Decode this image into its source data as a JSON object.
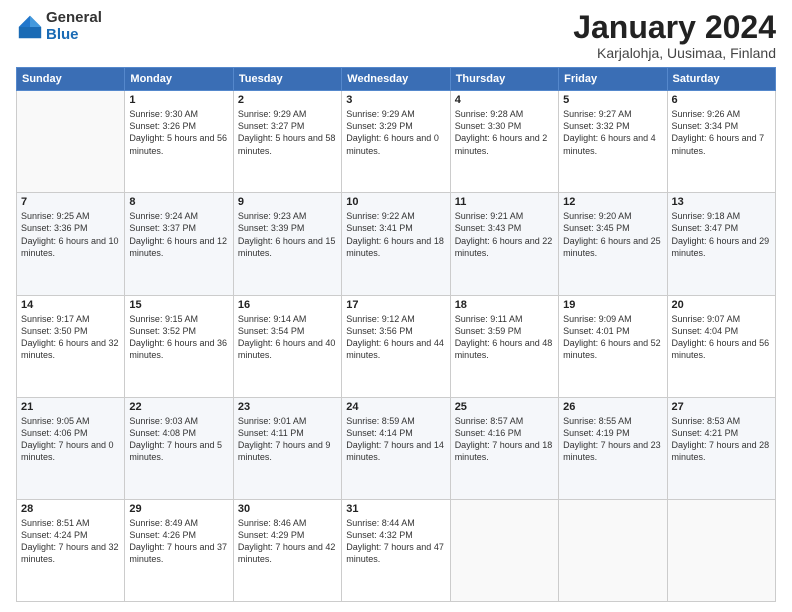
{
  "header": {
    "logo_general": "General",
    "logo_blue": "Blue",
    "title": "January 2024",
    "location": "Karjalohja, Uusimaa, Finland"
  },
  "weekdays": [
    "Sunday",
    "Monday",
    "Tuesday",
    "Wednesday",
    "Thursday",
    "Friday",
    "Saturday"
  ],
  "weeks": [
    [
      {
        "day": "",
        "info": ""
      },
      {
        "day": "1",
        "info": "Sunrise: 9:30 AM\nSunset: 3:26 PM\nDaylight: 5 hours\nand 56 minutes."
      },
      {
        "day": "2",
        "info": "Sunrise: 9:29 AM\nSunset: 3:27 PM\nDaylight: 5 hours\nand 58 minutes."
      },
      {
        "day": "3",
        "info": "Sunrise: 9:29 AM\nSunset: 3:29 PM\nDaylight: 6 hours\nand 0 minutes."
      },
      {
        "day": "4",
        "info": "Sunrise: 9:28 AM\nSunset: 3:30 PM\nDaylight: 6 hours\nand 2 minutes."
      },
      {
        "day": "5",
        "info": "Sunrise: 9:27 AM\nSunset: 3:32 PM\nDaylight: 6 hours\nand 4 minutes."
      },
      {
        "day": "6",
        "info": "Sunrise: 9:26 AM\nSunset: 3:34 PM\nDaylight: 6 hours\nand 7 minutes."
      }
    ],
    [
      {
        "day": "7",
        "info": "Sunrise: 9:25 AM\nSunset: 3:36 PM\nDaylight: 6 hours\nand 10 minutes."
      },
      {
        "day": "8",
        "info": "Sunrise: 9:24 AM\nSunset: 3:37 PM\nDaylight: 6 hours\nand 12 minutes."
      },
      {
        "day": "9",
        "info": "Sunrise: 9:23 AM\nSunset: 3:39 PM\nDaylight: 6 hours\nand 15 minutes."
      },
      {
        "day": "10",
        "info": "Sunrise: 9:22 AM\nSunset: 3:41 PM\nDaylight: 6 hours\nand 18 minutes."
      },
      {
        "day": "11",
        "info": "Sunrise: 9:21 AM\nSunset: 3:43 PM\nDaylight: 6 hours\nand 22 minutes."
      },
      {
        "day": "12",
        "info": "Sunrise: 9:20 AM\nSunset: 3:45 PM\nDaylight: 6 hours\nand 25 minutes."
      },
      {
        "day": "13",
        "info": "Sunrise: 9:18 AM\nSunset: 3:47 PM\nDaylight: 6 hours\nand 29 minutes."
      }
    ],
    [
      {
        "day": "14",
        "info": "Sunrise: 9:17 AM\nSunset: 3:50 PM\nDaylight: 6 hours\nand 32 minutes."
      },
      {
        "day": "15",
        "info": "Sunrise: 9:15 AM\nSunset: 3:52 PM\nDaylight: 6 hours\nand 36 minutes."
      },
      {
        "day": "16",
        "info": "Sunrise: 9:14 AM\nSunset: 3:54 PM\nDaylight: 6 hours\nand 40 minutes."
      },
      {
        "day": "17",
        "info": "Sunrise: 9:12 AM\nSunset: 3:56 PM\nDaylight: 6 hours\nand 44 minutes."
      },
      {
        "day": "18",
        "info": "Sunrise: 9:11 AM\nSunset: 3:59 PM\nDaylight: 6 hours\nand 48 minutes."
      },
      {
        "day": "19",
        "info": "Sunrise: 9:09 AM\nSunset: 4:01 PM\nDaylight: 6 hours\nand 52 minutes."
      },
      {
        "day": "20",
        "info": "Sunrise: 9:07 AM\nSunset: 4:04 PM\nDaylight: 6 hours\nand 56 minutes."
      }
    ],
    [
      {
        "day": "21",
        "info": "Sunrise: 9:05 AM\nSunset: 4:06 PM\nDaylight: 7 hours\nand 0 minutes."
      },
      {
        "day": "22",
        "info": "Sunrise: 9:03 AM\nSunset: 4:08 PM\nDaylight: 7 hours\nand 5 minutes."
      },
      {
        "day": "23",
        "info": "Sunrise: 9:01 AM\nSunset: 4:11 PM\nDaylight: 7 hours\nand 9 minutes."
      },
      {
        "day": "24",
        "info": "Sunrise: 8:59 AM\nSunset: 4:14 PM\nDaylight: 7 hours\nand 14 minutes."
      },
      {
        "day": "25",
        "info": "Sunrise: 8:57 AM\nSunset: 4:16 PM\nDaylight: 7 hours\nand 18 minutes."
      },
      {
        "day": "26",
        "info": "Sunrise: 8:55 AM\nSunset: 4:19 PM\nDaylight: 7 hours\nand 23 minutes."
      },
      {
        "day": "27",
        "info": "Sunrise: 8:53 AM\nSunset: 4:21 PM\nDaylight: 7 hours\nand 28 minutes."
      }
    ],
    [
      {
        "day": "28",
        "info": "Sunrise: 8:51 AM\nSunset: 4:24 PM\nDaylight: 7 hours\nand 32 minutes."
      },
      {
        "day": "29",
        "info": "Sunrise: 8:49 AM\nSunset: 4:26 PM\nDaylight: 7 hours\nand 37 minutes."
      },
      {
        "day": "30",
        "info": "Sunrise: 8:46 AM\nSunset: 4:29 PM\nDaylight: 7 hours\nand 42 minutes."
      },
      {
        "day": "31",
        "info": "Sunrise: 8:44 AM\nSunset: 4:32 PM\nDaylight: 7 hours\nand 47 minutes."
      },
      {
        "day": "",
        "info": ""
      },
      {
        "day": "",
        "info": ""
      },
      {
        "day": "",
        "info": ""
      }
    ]
  ]
}
